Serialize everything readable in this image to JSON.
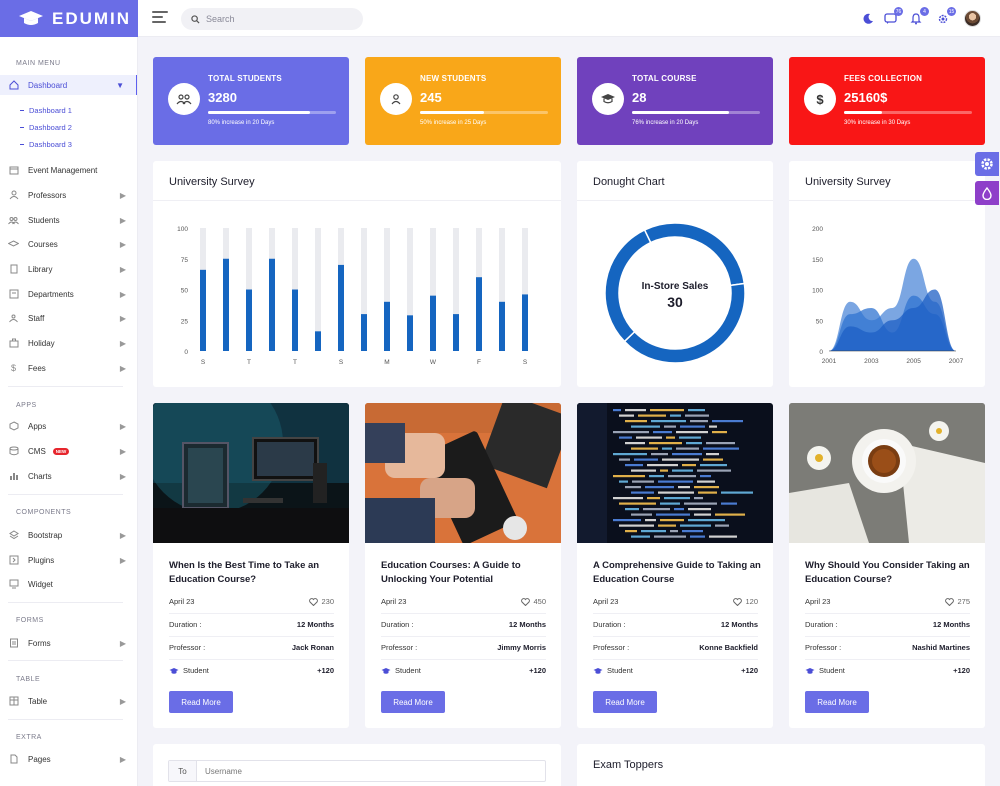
{
  "brand": {
    "name": "EDUMIN"
  },
  "search": {
    "placeholder": "Search"
  },
  "header": {
    "badges": {
      "messages": "76",
      "notifications": "4",
      "settings": "15"
    }
  },
  "sidebar": {
    "headings": [
      "MAIN MENU",
      "APPS",
      "COMPONENTS",
      "FORMS",
      "TABLE",
      "EXTRA"
    ],
    "dashboard": {
      "label": "Dashboard",
      "subitems": [
        "Dashboard 1",
        "Dashboard 2",
        "Dashboard 3"
      ]
    },
    "main_items": [
      "Event Management",
      "Professors",
      "Students",
      "Courses",
      "Library",
      "Departments",
      "Staff",
      "Holiday",
      "Fees"
    ],
    "apps_items": [
      "Apps",
      "CMS",
      "Charts"
    ],
    "new_badge": "NEW",
    "component_items": [
      "Bootstrap",
      "Plugins",
      "Widget"
    ],
    "form_items": [
      "Forms"
    ],
    "table_items": [
      "Table"
    ],
    "extra_items": [
      "Pages"
    ]
  },
  "stats": [
    {
      "label": "TOTAL STUDENTS",
      "value": "3280",
      "progress": 0.8,
      "note": "80% increase in 20 Days",
      "color": "#6a6de6",
      "icon": "users-icon"
    },
    {
      "label": "NEW STUDENTS",
      "value": "245",
      "progress": 0.5,
      "note": "50% increase in 25 Days",
      "color": "#f9a719",
      "icon": "user-icon"
    },
    {
      "label": "TOTAL COURSE",
      "value": "28",
      "progress": 0.76,
      "note": "76% increase in 20 Days",
      "color": "#7041bd",
      "icon": "graduation-cap-icon"
    },
    {
      "label": "FEES COLLECTION",
      "value": "25160$",
      "progress": 0.3,
      "note": "30% increase in 30 Days",
      "color": "#f91616",
      "icon": "dollar-icon"
    }
  ],
  "cards": {
    "survey_title": "University Survey",
    "donut_title": "Donught Chart",
    "survey2_title": "University Survey",
    "exam_title": "Exam Toppers"
  },
  "chart_data": [
    {
      "type": "bar",
      "title": "University Survey",
      "categories": [
        "S",
        "T",
        "T",
        "T",
        "T",
        "S",
        "S",
        "M",
        "M",
        "W",
        "W",
        "F",
        "F",
        "S"
      ],
      "tick_labels": [
        "S",
        "T",
        "T",
        "S",
        "M",
        "W",
        "F",
        "S"
      ],
      "values": [
        66,
        75,
        50,
        75,
        50,
        16,
        70,
        30,
        40,
        29,
        45,
        30,
        60,
        40,
        46
      ],
      "background_max": 100,
      "ylim": [
        0,
        100
      ],
      "yticks": [
        0,
        25,
        50,
        75,
        100
      ],
      "color": "#1565c0",
      "track_color": "#eaebef"
    },
    {
      "type": "pie",
      "title": "Donught Chart",
      "center_label": "In-Store Sales",
      "center_value": "30",
      "slices": [
        {
          "label": "In-Store Sales",
          "value": 30
        },
        {
          "label": "",
          "value": 40
        },
        {
          "label": "",
          "value": 30
        }
      ],
      "color": "#1565c0"
    },
    {
      "type": "area",
      "title": "University Survey",
      "x": [
        2001,
        2002,
        2003,
        2004,
        2005,
        2006,
        2007
      ],
      "xticks": [
        2001,
        2003,
        2005,
        2007
      ],
      "ylim": [
        0,
        200
      ],
      "yticks": [
        0,
        50,
        100,
        150,
        200
      ],
      "series": [
        {
          "values": [
            0,
            80,
            50,
            70,
            150,
            80,
            0
          ]
        },
        {
          "values": [
            0,
            60,
            70,
            30,
            90,
            60,
            0
          ]
        },
        {
          "values": [
            0,
            40,
            30,
            50,
            70,
            100,
            0
          ]
        }
      ],
      "colors": [
        "#4f88d8",
        "#2f73d0",
        "#1d5fc4"
      ]
    }
  ],
  "courses": [
    {
      "title": "When Is the Best Time to Take an Education Course?",
      "date": "April 23",
      "likes": "230",
      "duration_label": "Duration :",
      "duration": "12 Months",
      "professor_label": "Professor :",
      "professor": "Jack Ronan",
      "student_label": "Student",
      "students": "+120",
      "button": "Read More",
      "image": "desk-computers-photo"
    },
    {
      "title": "Education Courses: A Guide to Unlocking Your Potential",
      "date": "April 23",
      "likes": "450",
      "duration_label": "Duration :",
      "duration": "12 Months",
      "professor_label": "Professor :",
      "professor": "Jimmy Morris",
      "student_label": "Student",
      "students": "+120",
      "button": "Read More",
      "image": "typing-keyboard-photo"
    },
    {
      "title": "A Comprehensive Guide to Taking an Education Course",
      "date": "April 23",
      "likes": "120",
      "duration_label": "Duration :",
      "duration": "12 Months",
      "professor_label": "Professor :",
      "professor": "Konne Backfield",
      "student_label": "Student",
      "students": "+120",
      "button": "Read More",
      "image": "code-screen-photo"
    },
    {
      "title": "Why Should You Consider Taking an Education Course?",
      "date": "April 23",
      "likes": "275",
      "duration_label": "Duration :",
      "duration": "12 Months",
      "professor_label": "Professor :",
      "professor": "Nashid Martines",
      "student_label": "Student",
      "students": "+120",
      "button": "Read More",
      "image": "coffee-book-photo"
    }
  ],
  "compose": {
    "to_label": "To",
    "username_placeholder": "Username"
  }
}
